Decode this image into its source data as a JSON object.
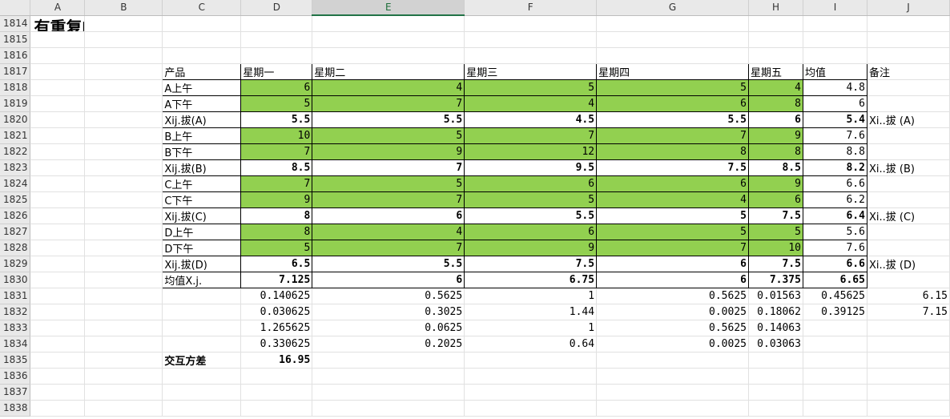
{
  "columns": [
    "A",
    "B",
    "C",
    "D",
    "E",
    "F",
    "G",
    "H",
    "I",
    "J"
  ],
  "selected_column": "E",
  "title": "有重复的双因素方差分析工具的验证（手动计算）",
  "row_numbers": [
    "1814",
    "1815",
    "1816",
    "1817",
    "1818",
    "1819",
    "1820",
    "1821",
    "1822",
    "1823",
    "1824",
    "1825",
    "1826",
    "1827",
    "1828",
    "1829",
    "1830",
    "1831",
    "1832",
    "1833",
    "1834",
    "1835",
    "1836",
    "1837",
    "1838"
  ],
  "header_row": [
    "产品",
    "星期一",
    "星期二",
    "星期三",
    "星期四",
    "星期五",
    "均值",
    "备注"
  ],
  "data_rows": [
    {
      "label": "A上午",
      "values": [
        "6",
        "4",
        "5",
        "5",
        "4"
      ],
      "mean": "4.8",
      "note": "",
      "kind": "raw"
    },
    {
      "label": "A下午",
      "values": [
        "5",
        "7",
        "4",
        "6",
        "8"
      ],
      "mean": "6",
      "note": "",
      "kind": "raw"
    },
    {
      "label": "Xij.拔(A)",
      "values": [
        "5.5",
        "5.5",
        "4.5",
        "5.5",
        "6"
      ],
      "mean": "5.4",
      "note": "Xi..拔 (A)",
      "kind": "avg"
    },
    {
      "label": "B上午",
      "values": [
        "10",
        "5",
        "7",
        "7",
        "9"
      ],
      "mean": "7.6",
      "note": "",
      "kind": "raw"
    },
    {
      "label": "B下午",
      "values": [
        "7",
        "9",
        "12",
        "8",
        "8"
      ],
      "mean": "8.8",
      "note": "",
      "kind": "raw"
    },
    {
      "label": "Xij.拔(B)",
      "values": [
        "8.5",
        "7",
        "9.5",
        "7.5",
        "8.5"
      ],
      "mean": "8.2",
      "note": "Xi..拔 (B)",
      "kind": "avg"
    },
    {
      "label": "C上午",
      "values": [
        "7",
        "5",
        "6",
        "6",
        "9"
      ],
      "mean": "6.6",
      "note": "",
      "kind": "raw"
    },
    {
      "label": "C下午",
      "values": [
        "9",
        "7",
        "5",
        "4",
        "6"
      ],
      "mean": "6.2",
      "note": "",
      "kind": "raw"
    },
    {
      "label": "Xij.拔(C)",
      "values": [
        "8",
        "6",
        "5.5",
        "5",
        "7.5"
      ],
      "mean": "6.4",
      "note": "Xi..拔 (C)",
      "kind": "avg"
    },
    {
      "label": "D上午",
      "values": [
        "8",
        "4",
        "6",
        "5",
        "5"
      ],
      "mean": "5.6",
      "note": "",
      "kind": "raw"
    },
    {
      "label": "D下午",
      "values": [
        "5",
        "7",
        "9",
        "7",
        "10"
      ],
      "mean": "7.6",
      "note": "",
      "kind": "raw"
    },
    {
      "label": "Xij.拔(D)",
      "values": [
        "6.5",
        "5.5",
        "7.5",
        "6",
        "7.5"
      ],
      "mean": "6.6",
      "note": "Xi..拔 (D)",
      "kind": "avg"
    },
    {
      "label": "均值X.j.",
      "values": [
        "7.125",
        "6",
        "6.75",
        "6",
        "7.375"
      ],
      "mean": "6.65",
      "note": "",
      "kind": "avg"
    }
  ],
  "calc_rows": [
    {
      "values": [
        "0.140625",
        "0.5625",
        "1",
        "0.5625",
        "0.01563"
      ],
      "mean": "0.45625",
      "note": "6.15"
    },
    {
      "values": [
        "0.030625",
        "0.3025",
        "1.44",
        "0.0025",
        "0.18062"
      ],
      "mean": "0.39125",
      "note": "7.15"
    },
    {
      "values": [
        "1.265625",
        "0.0625",
        "1",
        "0.5625",
        "0.14063"
      ],
      "mean": "",
      "note": ""
    },
    {
      "values": [
        "0.330625",
        "0.2025",
        "0.64",
        "0.0025",
        "0.03063"
      ],
      "mean": "",
      "note": ""
    }
  ],
  "interaction": {
    "label": "交互方差",
    "value": "16.95"
  },
  "colors": {
    "green_fill": "#92d050",
    "header_bg": "#e9e9e9",
    "selected_accent": "#217346"
  }
}
